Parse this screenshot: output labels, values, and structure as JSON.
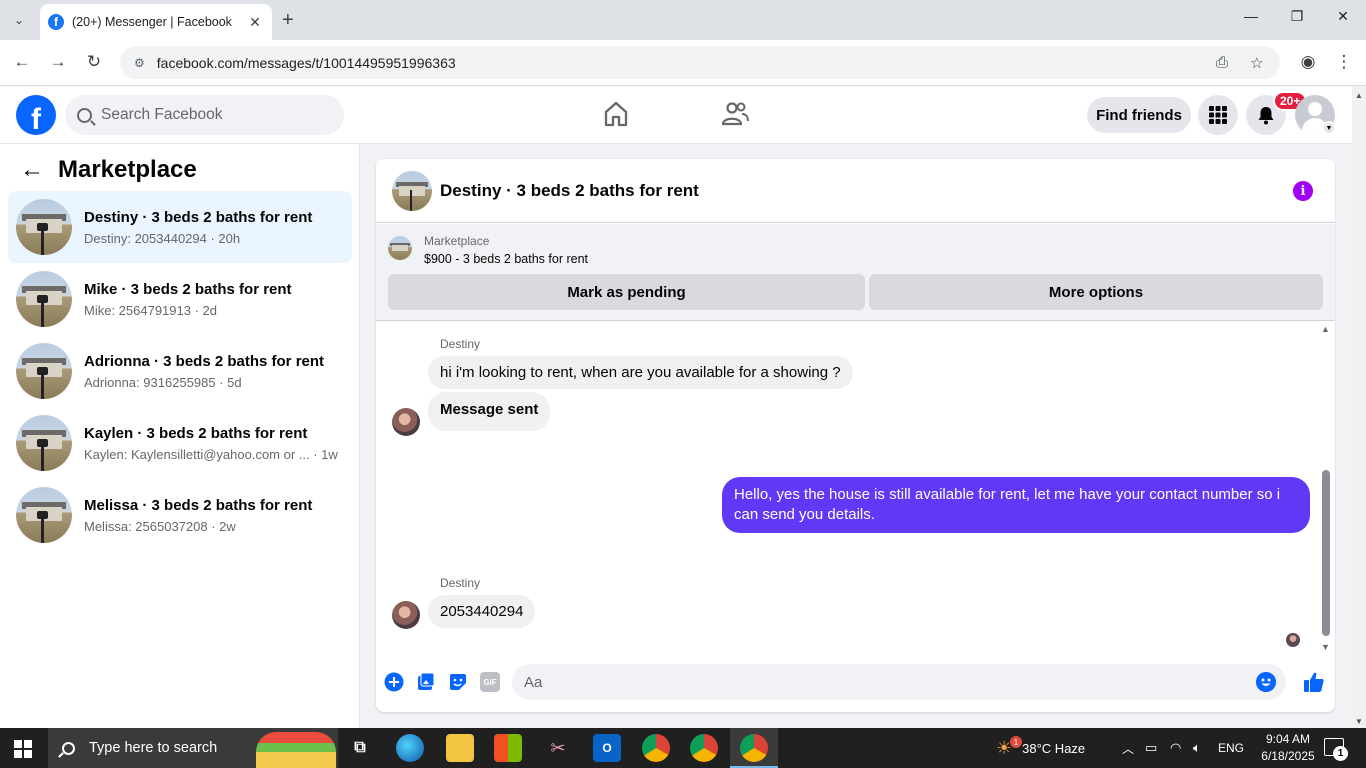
{
  "browser": {
    "tab_title": "(20+) Messenger | Facebook",
    "tab_favicon": "f",
    "url": "facebook.com/messages/t/100144959519963​63"
  },
  "fb_header": {
    "logo": "f",
    "search_placeholder": "Search Facebook",
    "find_friends": "Find friends",
    "notification_badge": "20+"
  },
  "sidebar": {
    "title": "Marketplace",
    "conversations": [
      {
        "name": "Destiny · 3 beds 2 baths for rent",
        "preview": "Destiny: 2053440294 · 20h"
      },
      {
        "name": "Mike · 3 beds 2 baths for rent",
        "preview": "Mike: 2564791913 · 2d"
      },
      {
        "name": "Adrionna · 3 beds 2 baths for rent",
        "preview": "Adrionna: 9316255985 · 5d"
      },
      {
        "name": "Kaylen · 3 beds 2 baths for rent",
        "preview": "Kaylen: Kaylensilletti@yahoo.com or ... · 1w"
      },
      {
        "name": "Melissa · 3 beds 2 baths for rent",
        "preview": "Melissa: 2565037208 · 2w"
      }
    ]
  },
  "chat": {
    "title": "Destiny · 3 beds 2 baths for rent",
    "marketplace_label": "Marketplace",
    "listing": "$900 - 3 beds 2 baths for rent",
    "mark_pending": "Mark as pending",
    "more_options": "More options",
    "messages": [
      {
        "sender": "Destiny",
        "text": "hi i'm looking to rent, when are you available for a showing ?"
      },
      {
        "text": "Message sent"
      },
      {
        "text": "Hello, yes the house is still available for rent, let me have your contact number so i can send you details."
      },
      {
        "sender": "Destiny",
        "text": "2053440294"
      }
    ],
    "composer_placeholder": "Aa",
    "gif_label": "GIF"
  },
  "taskbar": {
    "search_placeholder": "Type here to search",
    "weather": "38°C  Haze",
    "weather_badge": "1",
    "language": "ENG",
    "time": "9:04 AM",
    "date": "6/18/2025",
    "notif_count": "1"
  },
  "colors": {
    "fb_blue": "#0866ff",
    "outgoing_bubble": "#6138f5",
    "info_icon": "#a200f3",
    "badge_red": "#e41e3f"
  }
}
